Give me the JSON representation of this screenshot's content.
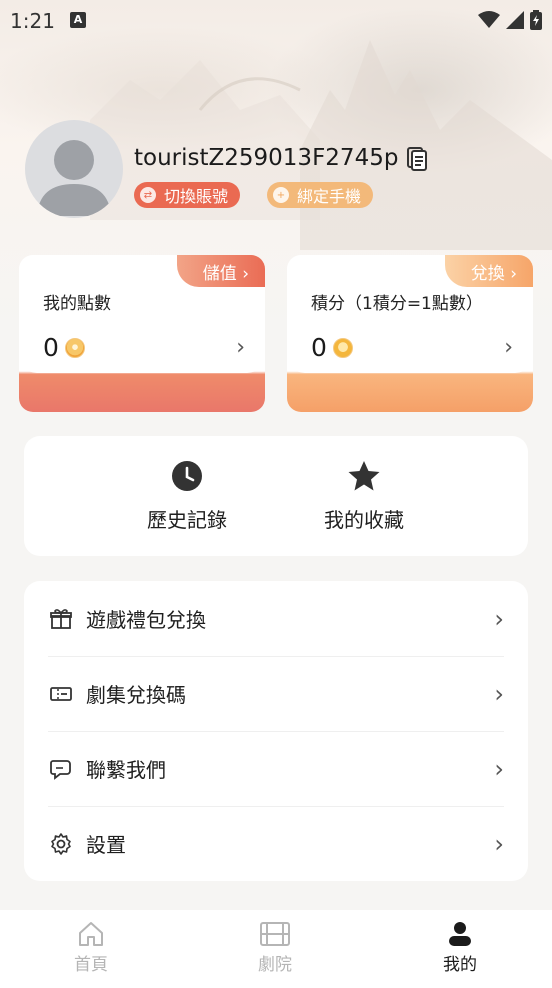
{
  "status_bar": {
    "time": "1:21",
    "app_badge": "A"
  },
  "profile": {
    "username": "touristZ259013F2745p",
    "switch_account_label": "切換賬號",
    "bind_phone_label": "綁定手機"
  },
  "cards": {
    "points": {
      "tag": "儲值 ›",
      "title": "我的點數",
      "value": "0"
    },
    "credits": {
      "tag": "兌換 ›",
      "title": "積分（1積分=1點數）",
      "value": "0"
    }
  },
  "quick_actions": {
    "history_label": "歷史記錄",
    "favorites_label": "我的收藏"
  },
  "menu": {
    "items": [
      {
        "label": "遊戲禮包兌換"
      },
      {
        "label": "劇集兌換碼"
      },
      {
        "label": "聯繫我們"
      },
      {
        "label": "設置"
      }
    ]
  },
  "tabs": {
    "home": "首頁",
    "theater": "劇院",
    "mine": "我的"
  },
  "colors": {
    "accent_red": "#ea6a52",
    "accent_orange": "#f3b97a",
    "background": "#f6f5f3"
  }
}
